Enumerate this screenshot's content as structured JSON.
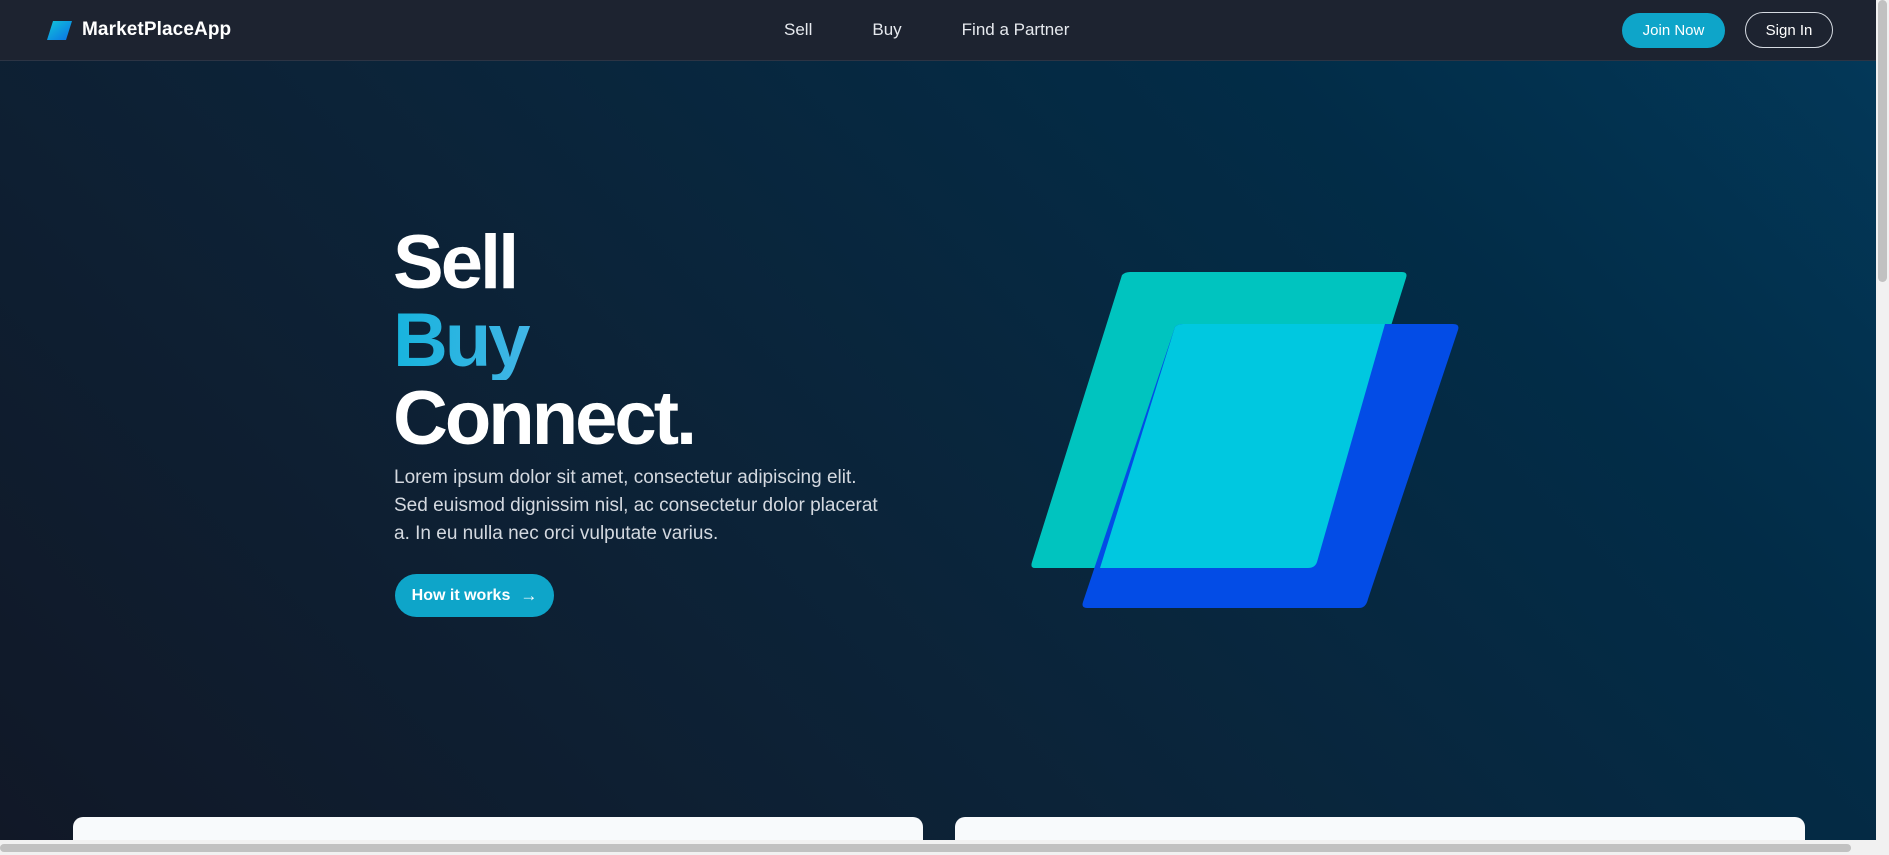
{
  "navbar": {
    "brand": {
      "name": "MarketPlaceApp",
      "logo_icon": "parallelogram-logo-icon"
    },
    "links": [
      {
        "label": "Sell"
      },
      {
        "label": "Buy"
      },
      {
        "label": "Find a Partner"
      }
    ],
    "join_label": "Join Now",
    "signin_label": "Sign In"
  },
  "hero": {
    "title_line1": "Sell",
    "title_line2": "Buy",
    "title_line3": "Connect.",
    "description": "Lorem ipsum dolor sit amet, consectetur adipiscing elit. Sed euismod dignissim nisl, ac consectetur dolor placerat a. In eu nulla nec orci vulputate varius.",
    "cta_label": "How it works",
    "cta_icon": "arrow-right-icon",
    "illustration": "overlapping-parallelograms-illustration"
  },
  "colors": {
    "accent": "#0ea5c9",
    "navbar_bg": "#1d2330",
    "teal_shape": "#00c4bf",
    "blue_shape": "#034ce6",
    "overlap_shape": "#00c8e0"
  }
}
